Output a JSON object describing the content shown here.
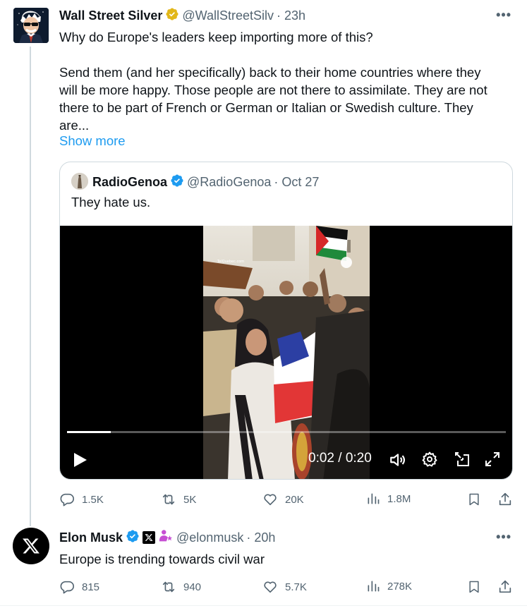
{
  "tweet": {
    "author_name": "Wall Street Silver",
    "handle": "@WallStreetSilv",
    "time": "· 23h",
    "verified_badge": "gold-verified-icon",
    "text_line1": "Why do Europe's leaders keep importing more of this?",
    "text_paragraph": "Send them (and her specifically) back to their home countries where they\nwill be more happy. Those people are not there to assimilate. They are not\nthere to be part of French or German or Italian or Swedish culture. They\nare...",
    "show_more": "Show more",
    "quote": {
      "author_name": "RadioGenoa",
      "handle": "@RadioGenoa",
      "time": "· Oct 27",
      "text": "They hate us.",
      "video": {
        "time_display": "0:02 / 0:20",
        "progress": 0.1,
        "watermark": "TelQuebec.com"
      }
    },
    "actions": {
      "replies": "1.5K",
      "reposts": "5K",
      "likes": "20K",
      "views": "1.8M"
    }
  },
  "reply": {
    "author_name": "Elon Musk",
    "handle": "@elonmusk",
    "time": "· 20h",
    "text": "Europe is trending towards civil war",
    "actions": {
      "replies": "815",
      "reposts": "940",
      "likes": "5.7K",
      "views": "278K"
    }
  },
  "colors": {
    "accent": "#1d9bf0",
    "gold_badge": "#e2b719",
    "secondary_text": "#536471"
  }
}
